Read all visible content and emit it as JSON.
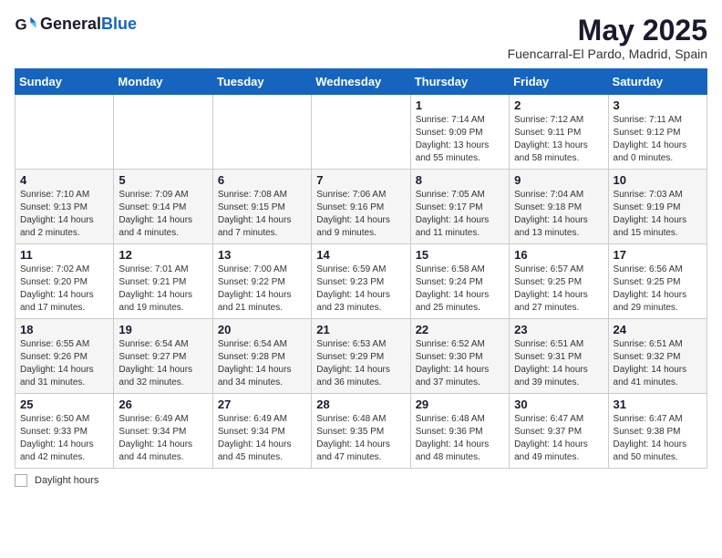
{
  "header": {
    "logo_general": "General",
    "logo_blue": "Blue",
    "title": "May 2025",
    "subtitle": "Fuencarral-El Pardo, Madrid, Spain"
  },
  "days_of_week": [
    "Sunday",
    "Monday",
    "Tuesday",
    "Wednesday",
    "Thursday",
    "Friday",
    "Saturday"
  ],
  "weeks": [
    [
      {
        "day": "",
        "info": ""
      },
      {
        "day": "",
        "info": ""
      },
      {
        "day": "",
        "info": ""
      },
      {
        "day": "",
        "info": ""
      },
      {
        "day": "1",
        "info": "Sunrise: 7:14 AM\nSunset: 9:09 PM\nDaylight: 13 hours and 55 minutes."
      },
      {
        "day": "2",
        "info": "Sunrise: 7:12 AM\nSunset: 9:11 PM\nDaylight: 13 hours and 58 minutes."
      },
      {
        "day": "3",
        "info": "Sunrise: 7:11 AM\nSunset: 9:12 PM\nDaylight: 14 hours and 0 minutes."
      }
    ],
    [
      {
        "day": "4",
        "info": "Sunrise: 7:10 AM\nSunset: 9:13 PM\nDaylight: 14 hours and 2 minutes."
      },
      {
        "day": "5",
        "info": "Sunrise: 7:09 AM\nSunset: 9:14 PM\nDaylight: 14 hours and 4 minutes."
      },
      {
        "day": "6",
        "info": "Sunrise: 7:08 AM\nSunset: 9:15 PM\nDaylight: 14 hours and 7 minutes."
      },
      {
        "day": "7",
        "info": "Sunrise: 7:06 AM\nSunset: 9:16 PM\nDaylight: 14 hours and 9 minutes."
      },
      {
        "day": "8",
        "info": "Sunrise: 7:05 AM\nSunset: 9:17 PM\nDaylight: 14 hours and 11 minutes."
      },
      {
        "day": "9",
        "info": "Sunrise: 7:04 AM\nSunset: 9:18 PM\nDaylight: 14 hours and 13 minutes."
      },
      {
        "day": "10",
        "info": "Sunrise: 7:03 AM\nSunset: 9:19 PM\nDaylight: 14 hours and 15 minutes."
      }
    ],
    [
      {
        "day": "11",
        "info": "Sunrise: 7:02 AM\nSunset: 9:20 PM\nDaylight: 14 hours and 17 minutes."
      },
      {
        "day": "12",
        "info": "Sunrise: 7:01 AM\nSunset: 9:21 PM\nDaylight: 14 hours and 19 minutes."
      },
      {
        "day": "13",
        "info": "Sunrise: 7:00 AM\nSunset: 9:22 PM\nDaylight: 14 hours and 21 minutes."
      },
      {
        "day": "14",
        "info": "Sunrise: 6:59 AM\nSunset: 9:23 PM\nDaylight: 14 hours and 23 minutes."
      },
      {
        "day": "15",
        "info": "Sunrise: 6:58 AM\nSunset: 9:24 PM\nDaylight: 14 hours and 25 minutes."
      },
      {
        "day": "16",
        "info": "Sunrise: 6:57 AM\nSunset: 9:25 PM\nDaylight: 14 hours and 27 minutes."
      },
      {
        "day": "17",
        "info": "Sunrise: 6:56 AM\nSunset: 9:25 PM\nDaylight: 14 hours and 29 minutes."
      }
    ],
    [
      {
        "day": "18",
        "info": "Sunrise: 6:55 AM\nSunset: 9:26 PM\nDaylight: 14 hours and 31 minutes."
      },
      {
        "day": "19",
        "info": "Sunrise: 6:54 AM\nSunset: 9:27 PM\nDaylight: 14 hours and 32 minutes."
      },
      {
        "day": "20",
        "info": "Sunrise: 6:54 AM\nSunset: 9:28 PM\nDaylight: 14 hours and 34 minutes."
      },
      {
        "day": "21",
        "info": "Sunrise: 6:53 AM\nSunset: 9:29 PM\nDaylight: 14 hours and 36 minutes."
      },
      {
        "day": "22",
        "info": "Sunrise: 6:52 AM\nSunset: 9:30 PM\nDaylight: 14 hours and 37 minutes."
      },
      {
        "day": "23",
        "info": "Sunrise: 6:51 AM\nSunset: 9:31 PM\nDaylight: 14 hours and 39 minutes."
      },
      {
        "day": "24",
        "info": "Sunrise: 6:51 AM\nSunset: 9:32 PM\nDaylight: 14 hours and 41 minutes."
      }
    ],
    [
      {
        "day": "25",
        "info": "Sunrise: 6:50 AM\nSunset: 9:33 PM\nDaylight: 14 hours and 42 minutes."
      },
      {
        "day": "26",
        "info": "Sunrise: 6:49 AM\nSunset: 9:34 PM\nDaylight: 14 hours and 44 minutes."
      },
      {
        "day": "27",
        "info": "Sunrise: 6:49 AM\nSunset: 9:34 PM\nDaylight: 14 hours and 45 minutes."
      },
      {
        "day": "28",
        "info": "Sunrise: 6:48 AM\nSunset: 9:35 PM\nDaylight: 14 hours and 47 minutes."
      },
      {
        "day": "29",
        "info": "Sunrise: 6:48 AM\nSunset: 9:36 PM\nDaylight: 14 hours and 48 minutes."
      },
      {
        "day": "30",
        "info": "Sunrise: 6:47 AM\nSunset: 9:37 PM\nDaylight: 14 hours and 49 minutes."
      },
      {
        "day": "31",
        "info": "Sunrise: 6:47 AM\nSunset: 9:38 PM\nDaylight: 14 hours and 50 minutes."
      }
    ]
  ],
  "footer": {
    "daylight_hours_label": "Daylight hours"
  }
}
